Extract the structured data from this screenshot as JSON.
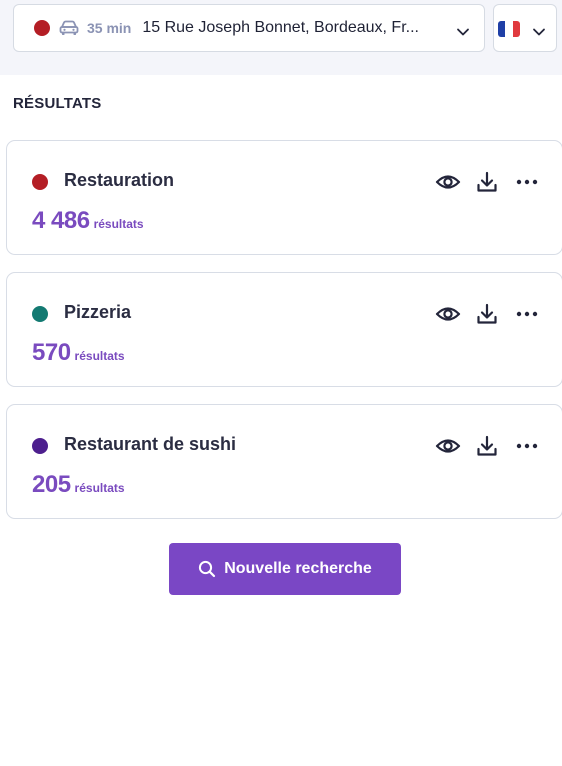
{
  "header": {
    "location": {
      "dot_color": "#b41e25",
      "transport_icon": "car-icon",
      "duration": "35 min",
      "address": "15 Rue Joseph Bonnet, Bordeaux, Fr..."
    },
    "language": {
      "flag_icon": "flag-france-icon",
      "flag_colors": [
        "#1f3fa6",
        "#ffffff",
        "#e03a3e"
      ]
    }
  },
  "results": {
    "title": "RÉSULTATS",
    "unit_label": "résultats",
    "cards": [
      {
        "name": "Restauration",
        "count": "4 486",
        "dot_color": "#b41e25"
      },
      {
        "name": "Pizzeria",
        "count": "570",
        "dot_color": "#137a72"
      },
      {
        "name": "Restaurant de sushi",
        "count": "205",
        "dot_color": "#4d1f8e"
      }
    ]
  },
  "actions": {
    "new_search_label": "Nouvelle recherche"
  },
  "colors": {
    "accent": "#7a47c5",
    "count_text": "#7a4bbf",
    "border": "#d8dde6"
  }
}
